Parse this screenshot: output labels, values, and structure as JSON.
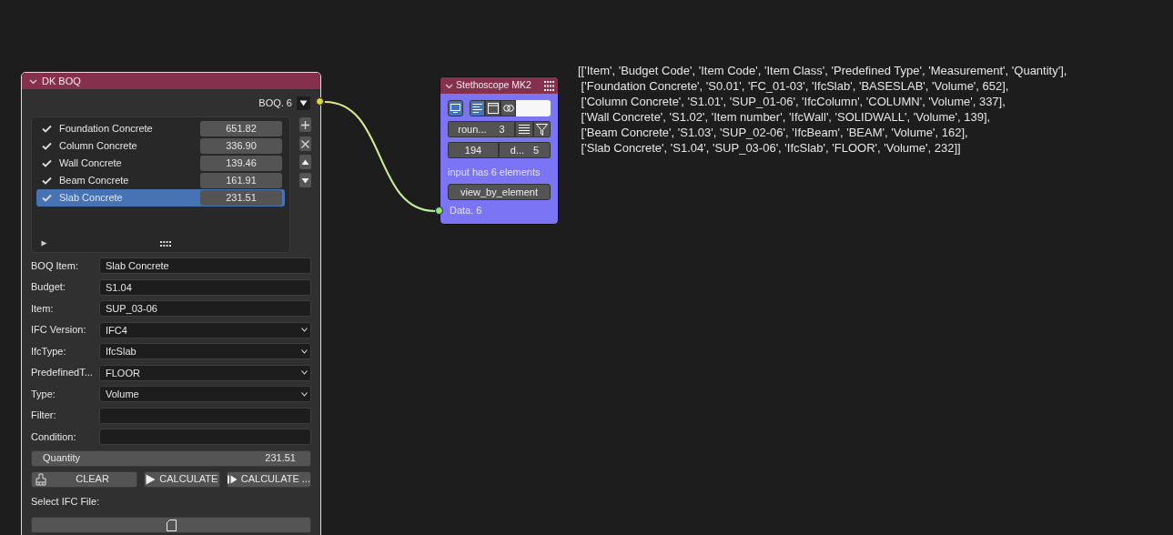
{
  "boq_node": {
    "title": "DK BOQ",
    "output_label": "BOQ. 6",
    "items": [
      {
        "name": "Foundation Concrete",
        "value": "651.82",
        "checked": true,
        "selected": false
      },
      {
        "name": "Column Concrete",
        "value": "336.90",
        "checked": true,
        "selected": false
      },
      {
        "name": "Wall Concrete",
        "value": "139.46",
        "checked": true,
        "selected": false
      },
      {
        "name": "Beam Concrete",
        "value": "161.91",
        "checked": true,
        "selected": false
      },
      {
        "name": "Slab Concrete",
        "value": "231.51",
        "checked": true,
        "selected": true
      }
    ],
    "fields": [
      {
        "label": "BOQ Item:",
        "value": "Slab Concrete",
        "kind": "text"
      },
      {
        "label": "Budget:",
        "value": "S1.04",
        "kind": "text"
      },
      {
        "label": "Item:",
        "value": "SUP_03-06",
        "kind": "text"
      },
      {
        "label": "IFC Version:",
        "value": "IFC4",
        "kind": "select"
      },
      {
        "label": "IfcType:",
        "value": "IfcSlab",
        "kind": "select"
      },
      {
        "label": "PredefinedT...",
        "value": "FLOOR",
        "kind": "select"
      },
      {
        "label": "Type:",
        "value": "Volume",
        "kind": "select"
      },
      {
        "label": "Filter:",
        "kind": "text"
      },
      {
        "label": "Condition:",
        "kind": "text"
      }
    ],
    "quantity": {
      "label": "Quantity",
      "value": "231.51"
    },
    "buttons": [
      {
        "label": "CLEAR",
        "kind": "clear"
      },
      {
        "label": "CALCULATE",
        "kind": "play"
      },
      {
        "label": "CALCULATE ...",
        "kind": "step"
      }
    ],
    "file_label": "Select IFC File:"
  },
  "stethoscope_node": {
    "title": "Stethoscope MK2",
    "display_on": true,
    "modes": [
      {
        "kind": "list",
        "selected": true
      },
      {
        "kind": "window",
        "selected": false
      },
      {
        "kind": "loop",
        "selected": false
      }
    ],
    "round_label": "roun...",
    "round_value": "3",
    "count": "194",
    "depth_label": "d...",
    "depth_value": "5",
    "info": "input has 6 elements",
    "button": "view_by_element",
    "input_label": "Data. 6"
  },
  "output_lines": [
    "[['Item', 'Budget Code', 'Item Code', 'Item Class', 'Predefined Type', 'Measurement', 'Quantity'],",
    " ['Foundation Concrete', 'S0.01', 'FC_01-03', 'IfcSlab', 'BASESLAB', 'Volume', 652],",
    " ['Column Concrete', 'S1.01', 'SUP_01-06', 'IfcColumn', 'COLUMN', 'Volume', 337],",
    " ['Wall Concrete', 'S1.02', 'Item number', 'IfcWall', 'SOLIDWALL', 'Volume', 139],",
    " ['Beam Concrete', 'S1.03', 'SUP_02-06', 'IfcBeam', 'BEAM', 'Volume', 162],",
    " ['Slab Concrete', 'S1.04', 'SUP_03-06', 'IfcSlab', 'FLOOR', 'Volume', 232]]"
  ]
}
